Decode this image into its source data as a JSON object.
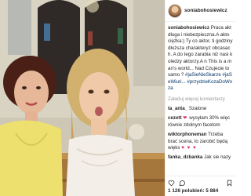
{
  "post": {
    "username": "soniabohosiewicz",
    "caption_username": "soniabohosiewicz",
    "caption_lines": [
      "Praca akt",
      "długa i niebezpieczna.A akto",
      "ciężka:) Ty co aktor, ti",
      "godziny dłuższa charakteryz",
      "obcasach. A do tego zarabia",
      "niż nasi koledzy aktorzy.A n",
      "This is a man's world... Nad",
      "Czujecie to samo ?"
    ],
    "hashtags": "#jaSieNieSkarze #jaSeWiuri... #przydzieKozaDoWoza",
    "load_more": "Załaduj więcej komentarzy"
  },
  "comments": [
    {
      "username": "ta_anta_",
      "text": "Szalone"
    },
    {
      "username": "cezett",
      "text": "wysyłam 30% więc równie zdolnym facetom",
      "emoji": "❤"
    },
    {
      "username": "wiktorphoneman",
      "text": "Trzeba brać scena, to zarobić będą więks",
      "hearts": "♥ ♥ ♥"
    },
    {
      "username": "fanka_dzbanka",
      "text": "Jak sie nazy"
    }
  ],
  "footer": {
    "likes_text": "1 126 polubień: 5 884"
  },
  "colors": {
    "link": "#003569",
    "muted": "#999999",
    "heart": "#e0245e"
  },
  "icons": [
    "heart-icon",
    "comment-icon",
    "bookmark-icon"
  ]
}
